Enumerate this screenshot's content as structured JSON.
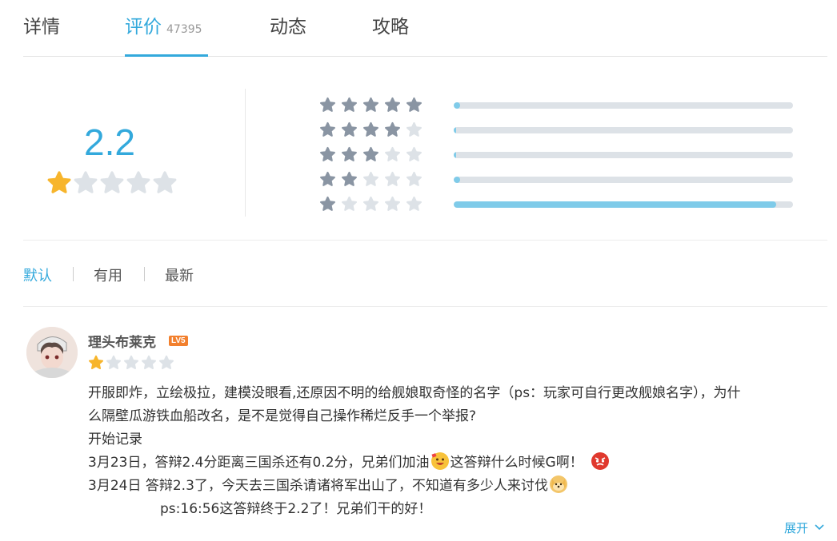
{
  "tabs": [
    {
      "label": "详情"
    },
    {
      "label": "评价",
      "count": "47395"
    },
    {
      "label": "动态"
    },
    {
      "label": "攻略"
    }
  ],
  "rating": {
    "score": "2.2",
    "stars_filled": 1,
    "distribution": [
      {
        "stars": 5,
        "fraction": 0.02
      },
      {
        "stars": 4,
        "fraction": 0.004
      },
      {
        "stars": 3,
        "fraction": 0.006
      },
      {
        "stars": 2,
        "fraction": 0.018
      },
      {
        "stars": 1,
        "fraction": 0.95
      }
    ]
  },
  "sort": {
    "default": "默认",
    "useful": "有用",
    "latest": "最新"
  },
  "review": {
    "username": "理头布莱克",
    "level": "LV5",
    "stars": 1,
    "lines": {
      "l1": "开服即炸，立绘极拉，建模没眼看,还原因不明的给舰娘取奇怪的名字（ps：玩家可自行更改舰娘名字），为什",
      "l2": "么隔壁瓜游铁血船改名，是不是觉得自己操作稀烂反手一个举报?",
      "l3": "开始记录",
      "l4a": "3月23日，答辩2.4分距离三国杀还有0.2分，兄弟们加油",
      "l4b": "这答辩什么时候G啊！",
      "l5": "3月24日  答辩2.3了，今天去三国杀请诸将军出山了，不知道有多少人来讨伐",
      "l6": "ps:16:56这答辩终于2.2了！兄弟们干的好！"
    },
    "expand": "展开"
  },
  "colors": {
    "accent": "#33a9dc",
    "star_gold": "#f7b52c",
    "star_dark": "#8a95a3",
    "star_empty": "#dde2e7",
    "bar_fill": "#7fcbe9"
  }
}
